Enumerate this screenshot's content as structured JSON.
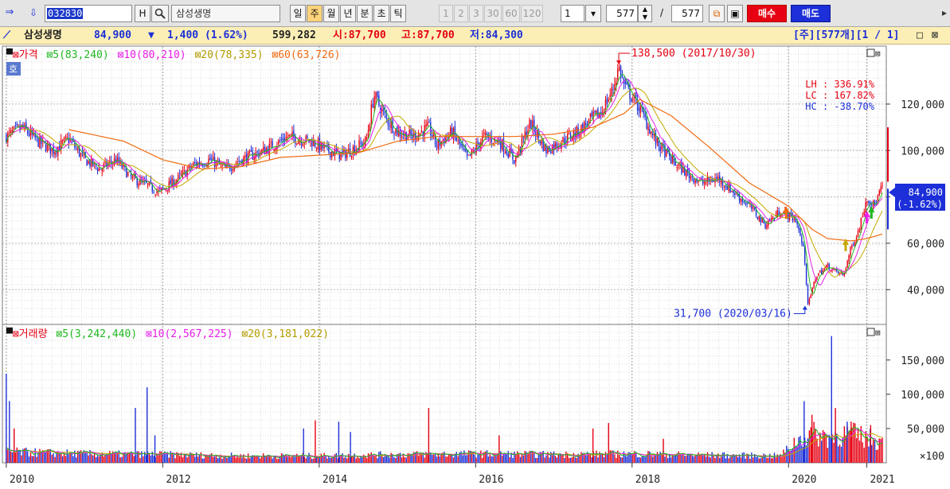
{
  "toolbar": {
    "code": "032830",
    "h_label": "H",
    "search_icon": "magnifier-icon",
    "stock_name": "삼성생명",
    "periods": [
      "일",
      "주",
      "월",
      "년",
      "분",
      "초",
      "틱"
    ],
    "selected_period": "주",
    "intervals": [
      "1",
      "2",
      "3",
      "30",
      "60",
      "120"
    ],
    "multiplier": "1",
    "count": "577",
    "slash": "/",
    "total": "577",
    "buy_label": "매수",
    "sell_label": "매도"
  },
  "info": {
    "name": "삼성생명",
    "price": "84,900",
    "arrow": "▼",
    "change": "1,400 (1.62%)",
    "volume": "599,282",
    "open": "시:87,700",
    "high": "고:87,700",
    "low": "저:84,300",
    "right": "[주][577개][1 / 1]"
  },
  "colors": {
    "up": "#e60012",
    "down": "#1c2fd8",
    "ma5": "#21b821",
    "ma10": "#e81ee8",
    "ma20": "#c4a800",
    "ma60": "#f06a10"
  },
  "chart_data": [
    {
      "type": "candlestick",
      "title": "가격",
      "hoga_label": "호",
      "legend": [
        {
          "name": "5",
          "value": "83,240"
        },
        {
          "name": "10",
          "value": "80,210"
        },
        {
          "name": "20",
          "value": "78,335"
        },
        {
          "name": "60",
          "value": "63,726"
        }
      ],
      "x_ticks": [
        "2010",
        "2012",
        "2014",
        "2016",
        "2018",
        "2020",
        "2021"
      ],
      "x_tick_pos": [
        2010.0,
        2012.0,
        2014.0,
        2016.0,
        2018.0,
        2020.0,
        2021.0
      ],
      "x_range": [
        2009.95,
        2021.25
      ],
      "y_ticks": [
        40000,
        60000,
        80000,
        100000,
        120000
      ],
      "y_tick_labels": [
        "40,000",
        "60,000",
        "80,000",
        "100,000",
        "120,000"
      ],
      "ylim": [
        25000,
        145000
      ],
      "close_series": {
        "x": [
          2010.0,
          2010.2,
          2010.4,
          2010.6,
          2010.8,
          2011.0,
          2011.2,
          2011.4,
          2011.6,
          2011.8,
          2011.95,
          2012.2,
          2012.4,
          2012.6,
          2012.8,
          2013.0,
          2013.3,
          2013.6,
          2013.9,
          2014.1,
          2014.3,
          2014.6,
          2014.7,
          2014.85,
          2015.0,
          2015.2,
          2015.4,
          2015.5,
          2015.7,
          2015.9,
          2016.1,
          2016.3,
          2016.5,
          2016.7,
          2016.9,
          2017.1,
          2017.3,
          2017.5,
          2017.6,
          2017.75,
          2017.83,
          2017.9,
          2018.1,
          2018.3,
          2018.5,
          2018.7,
          2018.9,
          2019.1,
          2019.3,
          2019.5,
          2019.7,
          2019.9,
          2020.1,
          2020.2,
          2020.25,
          2020.35,
          2020.5,
          2020.7,
          2020.8,
          2020.9,
          2021.0,
          2021.1,
          2021.2
        ],
        "y": [
          106000,
          110000,
          104000,
          100000,
          105000,
          96000,
          92000,
          96000,
          88000,
          85000,
          82000,
          88000,
          94000,
          96000,
          92000,
          96000,
          100000,
          106000,
          104000,
          100000,
          98000,
          104000,
          124000,
          114000,
          108000,
          106000,
          110000,
          102000,
          108000,
          96000,
          106000,
          104000,
          96000,
          112000,
          100000,
          104000,
          108000,
          114000,
          116000,
          126000,
          136000,
          128000,
          118000,
          104000,
          96000,
          90000,
          86000,
          88000,
          82000,
          76000,
          68000,
          74000,
          70000,
          56000,
          33000,
          46000,
          50000,
          46000,
          58000,
          66000,
          80000,
          76000,
          84900
        ]
      },
      "ma60_series": {
        "x": [
          2010.8,
          2011.5,
          2012.0,
          2012.5,
          2013.0,
          2013.5,
          2014.0,
          2014.5,
          2015.0,
          2015.5,
          2016.0,
          2016.5,
          2017.0,
          2017.5,
          2017.9,
          2018.1,
          2018.5,
          2019.0,
          2019.5,
          2020.0,
          2020.3,
          2020.5,
          2020.8,
          2021.0,
          2021.2
        ],
        "y": [
          109000,
          104000,
          96000,
          92000,
          93000,
          97000,
          98000,
          99000,
          104000,
          106000,
          106000,
          106000,
          107000,
          110000,
          116000,
          122000,
          115000,
          101000,
          86000,
          76000,
          66000,
          62000,
          61000,
          62000,
          64000
        ]
      },
      "annotations": [
        {
          "text": "138,500 (2017/10/30)",
          "x": 2017.83,
          "y": 138500,
          "side": "right"
        },
        {
          "text": "31,700 (2020/03/16)",
          "x": 2020.21,
          "y": 31700,
          "side": "left"
        }
      ],
      "stats": [
        "LH : 336.91%",
        "LC : 167.82%",
        "HC : -38.70%"
      ],
      "price_tag": {
        "value": "84,900",
        "change": "(-1.62%)",
        "y": 84900
      }
    },
    {
      "type": "bar",
      "title": "거래량",
      "legend": [
        {
          "name": "5",
          "value": "3,242,440"
        },
        {
          "name": "10",
          "value": "2,567,225"
        },
        {
          "name": "20",
          "value": "3,181,022"
        }
      ],
      "y_ticks": [
        50000,
        100000,
        150000
      ],
      "y_tick_labels": [
        "50,000",
        "100,000",
        "150,000"
      ],
      "unit_label": "×100",
      "ylim": [
        0,
        195000
      ],
      "level_points": {
        "x": [
          2010.0,
          2011.0,
          2012.0,
          2013.0,
          2014.0,
          2015.0,
          2016.0,
          2017.0,
          2018.0,
          2019.0,
          2019.9,
          2020.1,
          2020.3,
          2020.5,
          2020.8,
          2021.0,
          2021.2
        ],
        "y": [
          16000,
          13000,
          12000,
          10000,
          10000,
          12000,
          13000,
          12000,
          13000,
          11000,
          10000,
          32000,
          42000,
          38000,
          42000,
          36000,
          30000
        ]
      },
      "spikes": [
        {
          "x": 2010.0,
          "y": 130000
        },
        {
          "x": 2010.04,
          "y": 90000
        },
        {
          "x": 2010.1,
          "y": 50000
        },
        {
          "x": 2011.65,
          "y": 80000
        },
        {
          "x": 2011.8,
          "y": 110000
        },
        {
          "x": 2011.9,
          "y": 40000
        },
        {
          "x": 2013.8,
          "y": 50000
        },
        {
          "x": 2013.95,
          "y": 62000
        },
        {
          "x": 2014.25,
          "y": 60000
        },
        {
          "x": 2014.4,
          "y": 45000
        },
        {
          "x": 2015.4,
          "y": 80000
        },
        {
          "x": 2016.3,
          "y": 40000
        },
        {
          "x": 2017.5,
          "y": 50000
        },
        {
          "x": 2017.7,
          "y": 58000
        },
        {
          "x": 2018.4,
          "y": 35000
        },
        {
          "x": 2020.2,
          "y": 90000
        },
        {
          "x": 2020.3,
          "y": 70000
        },
        {
          "x": 2020.55,
          "y": 185000
        },
        {
          "x": 2020.6,
          "y": 80000
        },
        {
          "x": 2020.75,
          "y": 60000
        },
        {
          "x": 2020.8,
          "y": 60000
        },
        {
          "x": 2021.05,
          "y": 55000
        }
      ]
    }
  ]
}
